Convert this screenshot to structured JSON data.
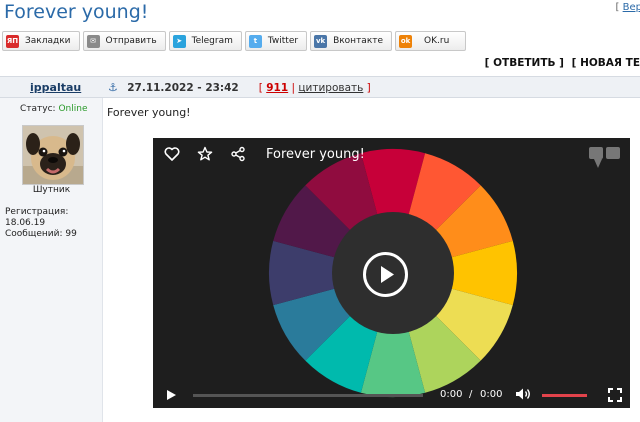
{
  "page": {
    "title": "Forever young!",
    "top_link_prefix": "[",
    "top_link_text": "Вер"
  },
  "share": [
    {
      "label": "Закладки",
      "icon": "yap-icon",
      "glyph": "ЯП",
      "color": "#d92b2b"
    },
    {
      "label": "Отправить",
      "icon": "envelope-icon",
      "glyph": "✉",
      "color": "#8a8a8a"
    },
    {
      "label": "Telegram",
      "icon": "telegram-icon",
      "glyph": "➤",
      "color": "#2aa3dd"
    },
    {
      "label": "Twitter",
      "icon": "twitter-icon",
      "glyph": "t",
      "color": "#55acee"
    },
    {
      "label": "Вконтакте",
      "icon": "vk-icon",
      "glyph": "vk",
      "color": "#4a76a8"
    },
    {
      "label": "OK.ru",
      "icon": "ok-icon",
      "glyph": "ok",
      "color": "#ee8208"
    }
  ],
  "actions": {
    "reply": "[ ОТВЕТИТЬ ]",
    "new_topic": "[ НОВАЯ ТЕ"
  },
  "post": {
    "author": "ippaltau",
    "date": "27.11.2022 - 23:42",
    "bracket_open": "[",
    "number": "911",
    "separator": "|",
    "quote": "цитировать",
    "bracket_close": "]",
    "text": "Forever young!"
  },
  "user": {
    "status_label": "Статус:",
    "status_value": "Online",
    "rank": "Шутник",
    "reg_label": "Регистрация:",
    "reg_date": "18.06.19",
    "messages_label": "Сообщений:",
    "messages": "99"
  },
  "player": {
    "title": "Forever young!",
    "time_current": "0:00",
    "time_separator": "/",
    "time_duration": "0:00",
    "progress": 0,
    "volume": 1.0,
    "volume_color": "#e2434b",
    "wheel_colors": [
      "#c70039",
      "#ff5733",
      "#ff8d1a",
      "#ffc300",
      "#eddd53",
      "#add45c",
      "#57c785",
      "#00baad",
      "#2a7b9b",
      "#3d3d6b",
      "#511849",
      "#900c3f"
    ]
  }
}
